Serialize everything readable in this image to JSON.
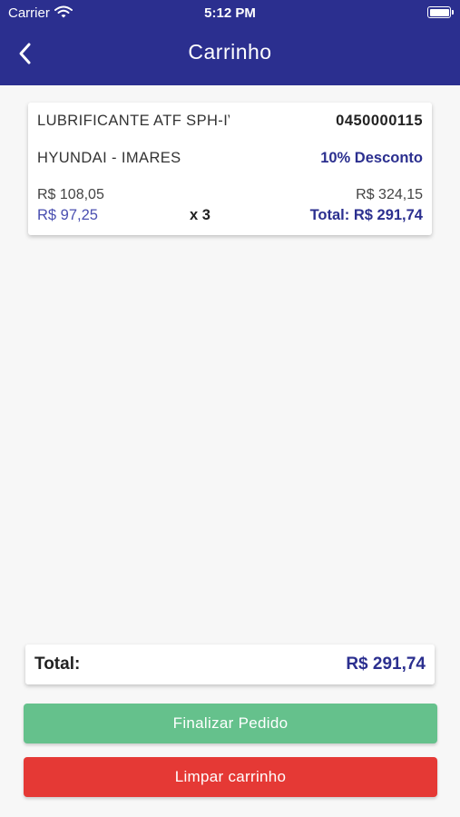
{
  "status_bar": {
    "carrier": "Carrier",
    "time": "5:12 PM"
  },
  "nav": {
    "title": "Carrinho",
    "back_icon": "chevron-left-icon"
  },
  "cart_items": [
    {
      "name": "LUBRIFICANTE ATF SPH-IV",
      "code": "0450000115",
      "brand": "HYUNDAI - IMARES",
      "discount": "10% Desconto",
      "unit_price_original": "R$ 108,05",
      "unit_price_discounted": "R$ 97,25",
      "quantity": "x 3",
      "subtotal_original": "R$ 324,15",
      "total": "Total: R$ 291,74"
    }
  ],
  "summary": {
    "label": "Total:",
    "value": "R$ 291,74"
  },
  "actions": {
    "finish_label": "Finalizar Pedido",
    "clear_label": "Limpar carrinho"
  },
  "colors": {
    "primary": "#2b2f8f",
    "background": "#f7f7f7",
    "finish_button": "#65c18c",
    "clear_button": "#e53935",
    "discount_price": "#4a4fb0"
  }
}
